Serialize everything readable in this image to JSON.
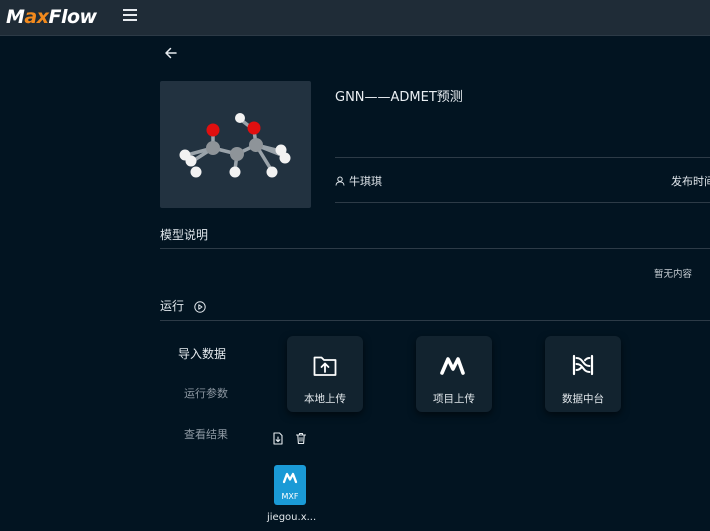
{
  "app": {
    "logo_main_left": "M",
    "logo_ax": "ax",
    "logo_main_right": "Flow",
    "menu_icon": "hamburger-icon",
    "back_icon": "arrow-left-icon",
    "brand_color": "#f28a1d"
  },
  "model": {
    "title": "GNN——ADMET预测",
    "author": "牛琪琪",
    "author_icon": "user-icon",
    "publish_label": "发布时间",
    "image": "molecule-3d-model"
  },
  "description": {
    "title": "模型说明",
    "empty_text": "暂无内容"
  },
  "run": {
    "title": "运行",
    "icon": "play-circle-icon",
    "steps": [
      {
        "label": "导入数据",
        "active": true
      },
      {
        "label": "运行参数",
        "active": false
      },
      {
        "label": "查看结果",
        "active": false
      }
    ],
    "upload_options": [
      {
        "label": "本地上传",
        "icon": "upload-folder-icon"
      },
      {
        "label": "项目上传",
        "icon": "maxflow-logo-icon"
      },
      {
        "label": "数据中台",
        "icon": "data-platform-icon"
      }
    ],
    "file_actions": [
      {
        "icon": "file-export-icon"
      },
      {
        "icon": "trash-icon"
      }
    ],
    "file": {
      "ext": "MXF",
      "name": "jiegou.x...",
      "tile_color": "#1a9ad6"
    }
  }
}
